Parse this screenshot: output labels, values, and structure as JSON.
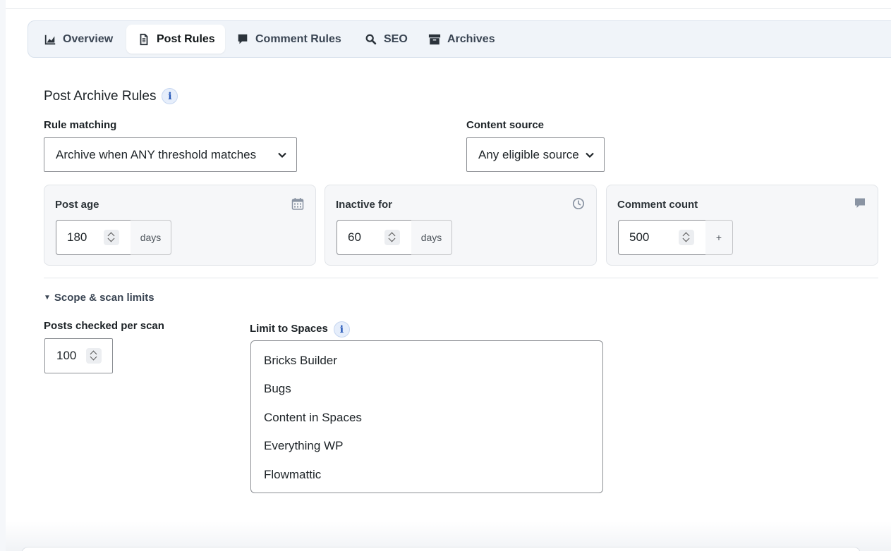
{
  "tabs": [
    {
      "label": "Overview",
      "icon": "chart-area-icon",
      "active": false
    },
    {
      "label": "Post Rules",
      "icon": "document-icon",
      "active": true
    },
    {
      "label": "Comment Rules",
      "icon": "comment-icon",
      "active": false
    },
    {
      "label": "SEO",
      "icon": "search-icon",
      "active": false
    },
    {
      "label": "Archives",
      "icon": "archive-box-icon",
      "active": false
    }
  ],
  "section": {
    "title": "Post Archive Rules"
  },
  "rule_matching": {
    "label": "Rule matching",
    "selected": "Archive when ANY threshold matches"
  },
  "content_source": {
    "label": "Content source",
    "selected": "Any eligible source"
  },
  "rules": {
    "post_age": {
      "title": "Post age",
      "value": "180",
      "unit": "days",
      "icon": "calendar-icon"
    },
    "inactive_for": {
      "title": "Inactive for",
      "value": "60",
      "unit": "days",
      "icon": "clock-icon"
    },
    "comment_count": {
      "title": "Comment count",
      "value": "500",
      "unit": "+",
      "icon": "comment-icon"
    }
  },
  "scope": {
    "toggle_label": "Scope & scan limits",
    "posts_per_scan_label": "Posts checked per scan",
    "posts_per_scan_value": "100",
    "limit_spaces_label": "Limit to Spaces",
    "spaces": [
      "Bricks Builder",
      "Bugs",
      "Content in Spaces",
      "Everything WP",
      "Flowmattic"
    ]
  },
  "colors": {
    "info_accent": "#2557b8",
    "tab_bar_bg": "#f0f4f9",
    "card_bg": "#f6f7f9"
  }
}
